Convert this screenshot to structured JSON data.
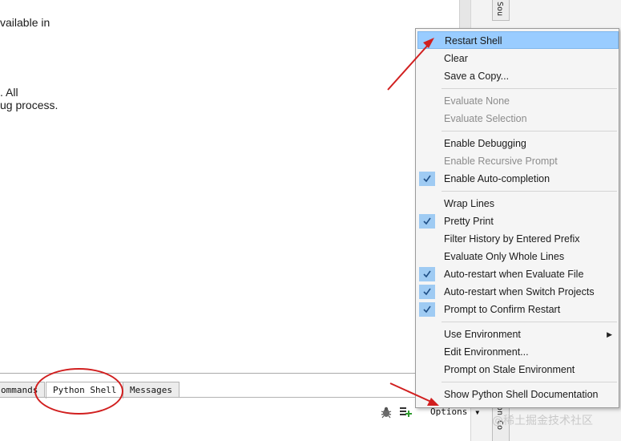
{
  "editor": {
    "fragments": [
      "vailable in",
      ". All",
      "ug process."
    ]
  },
  "side_tabs": {
    "top": "Sou",
    "bottom": "on Co"
  },
  "bottom_tabs": [
    "ommands",
    "Python Shell",
    "Messages"
  ],
  "toolbar": {
    "options_label": "Options",
    "icons": [
      "bug-icon",
      "list-add-icon"
    ]
  },
  "menu": {
    "items": [
      {
        "label": "Restart Shell",
        "state": "highlighted"
      },
      {
        "label": "Clear"
      },
      {
        "label": "Save a Copy..."
      },
      {
        "label": "Evaluate None",
        "state": "disabled"
      },
      {
        "label": "Evaluate Selection",
        "state": "disabled"
      },
      {
        "label": "Enable Debugging"
      },
      {
        "label": "Enable Recursive Prompt",
        "state": "disabled"
      },
      {
        "label": "Enable Auto-completion",
        "checked": true
      },
      {
        "label": "Wrap Lines"
      },
      {
        "label": "Pretty Print",
        "checked": true
      },
      {
        "label": "Filter History by Entered Prefix"
      },
      {
        "label": "Evaluate Only Whole Lines"
      },
      {
        "label": "Auto-restart when Evaluate File",
        "checked": true
      },
      {
        "label": "Auto-restart when Switch Projects",
        "checked": true
      },
      {
        "label": "Prompt to Confirm Restart",
        "checked": true
      },
      {
        "label": "Use Environment",
        "submenu": true
      },
      {
        "label": "Edit Environment..."
      },
      {
        "label": "Prompt on Stale Environment"
      },
      {
        "label": "Show Python Shell Documentation"
      }
    ]
  },
  "watermark": "@稀土掘金技术社区",
  "colors": {
    "highlight": "#99ccff",
    "check_bg": "#9fcbf3",
    "annotation_red": "#d11f1f"
  }
}
